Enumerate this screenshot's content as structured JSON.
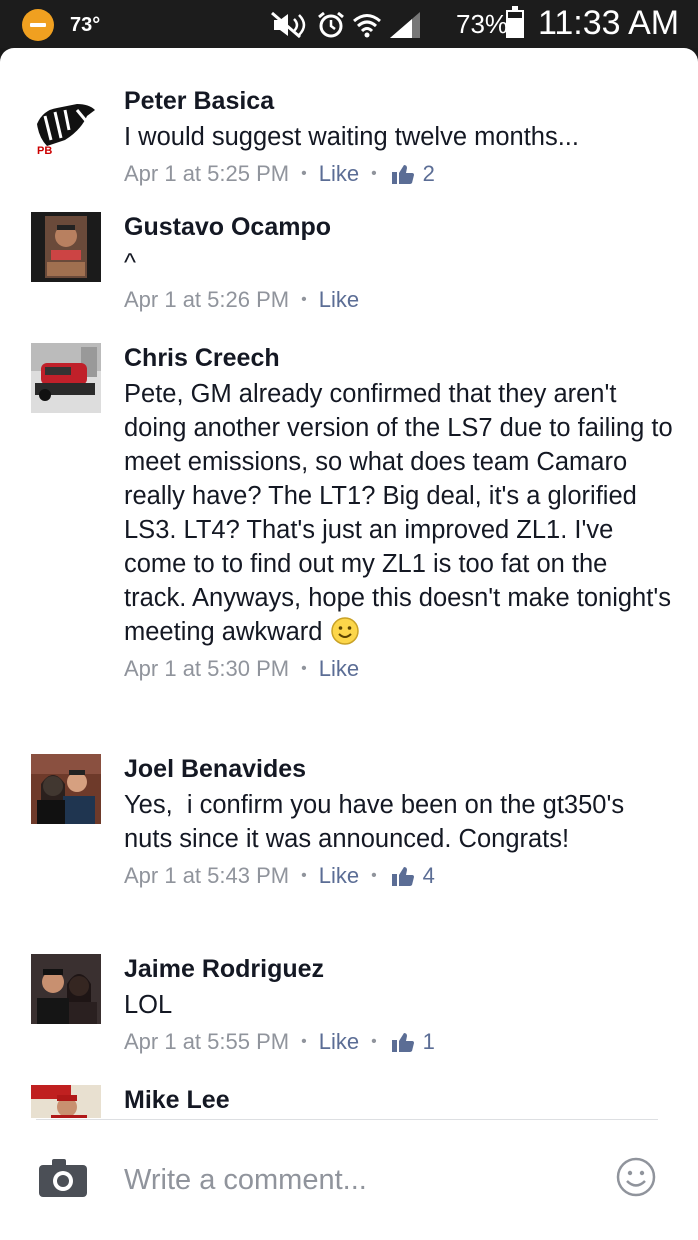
{
  "status_bar": {
    "temperature": "73°",
    "battery_percent": "73%",
    "battery_level": 0.73,
    "time": "11:33 AM",
    "icons": [
      "do-not-disturb-icon",
      "mute-icon",
      "alarm-icon",
      "wifi-icon",
      "signal-icon",
      "battery-icon"
    ]
  },
  "comments": [
    {
      "author": "Peter Basica",
      "text": "I would suggest waiting twelve months...",
      "time": "Apr 1 at 5:25 PM",
      "like_label": "Like",
      "like_count": "2"
    },
    {
      "author": "Gustavo Ocampo",
      "text": "^",
      "time": "Apr 1 at 5:26 PM",
      "like_label": "Like",
      "like_count": ""
    },
    {
      "author": "Chris Creech",
      "text": "Pete, GM already confirmed that they aren't doing another version of the LS7 due to failing to meet emissions, so what does team Camaro really have? The LT1? Big deal, it's a glorified LS3. LT4? That's just an improved ZL1. I've come to to find out my ZL1 is too fat on the track. Anyways, hope this doesn't make tonight's meeting awkward",
      "time": "Apr 1 at 5:30 PM",
      "like_label": "Like",
      "like_count": ""
    },
    {
      "author": "Joel Benavides",
      "text": "Yes,  i confirm you have been on the gt350's nuts since it was announced. Congrats!",
      "time": "Apr 1 at 5:43 PM",
      "like_label": "Like",
      "like_count": "4"
    },
    {
      "author": "Jaime Rodriguez",
      "text": "LOL",
      "time": "Apr 1 at 5:55 PM",
      "like_label": "Like",
      "like_count": "1"
    },
    {
      "author": "Mike Lee",
      "text": "",
      "time": "",
      "like_label": "",
      "like_count": ""
    }
  ],
  "composer": {
    "placeholder": "Write a comment..."
  },
  "colors": {
    "link": "#5b6d95",
    "meta": "#90949c",
    "text": "#141823",
    "status_accent": "#f0a020"
  }
}
